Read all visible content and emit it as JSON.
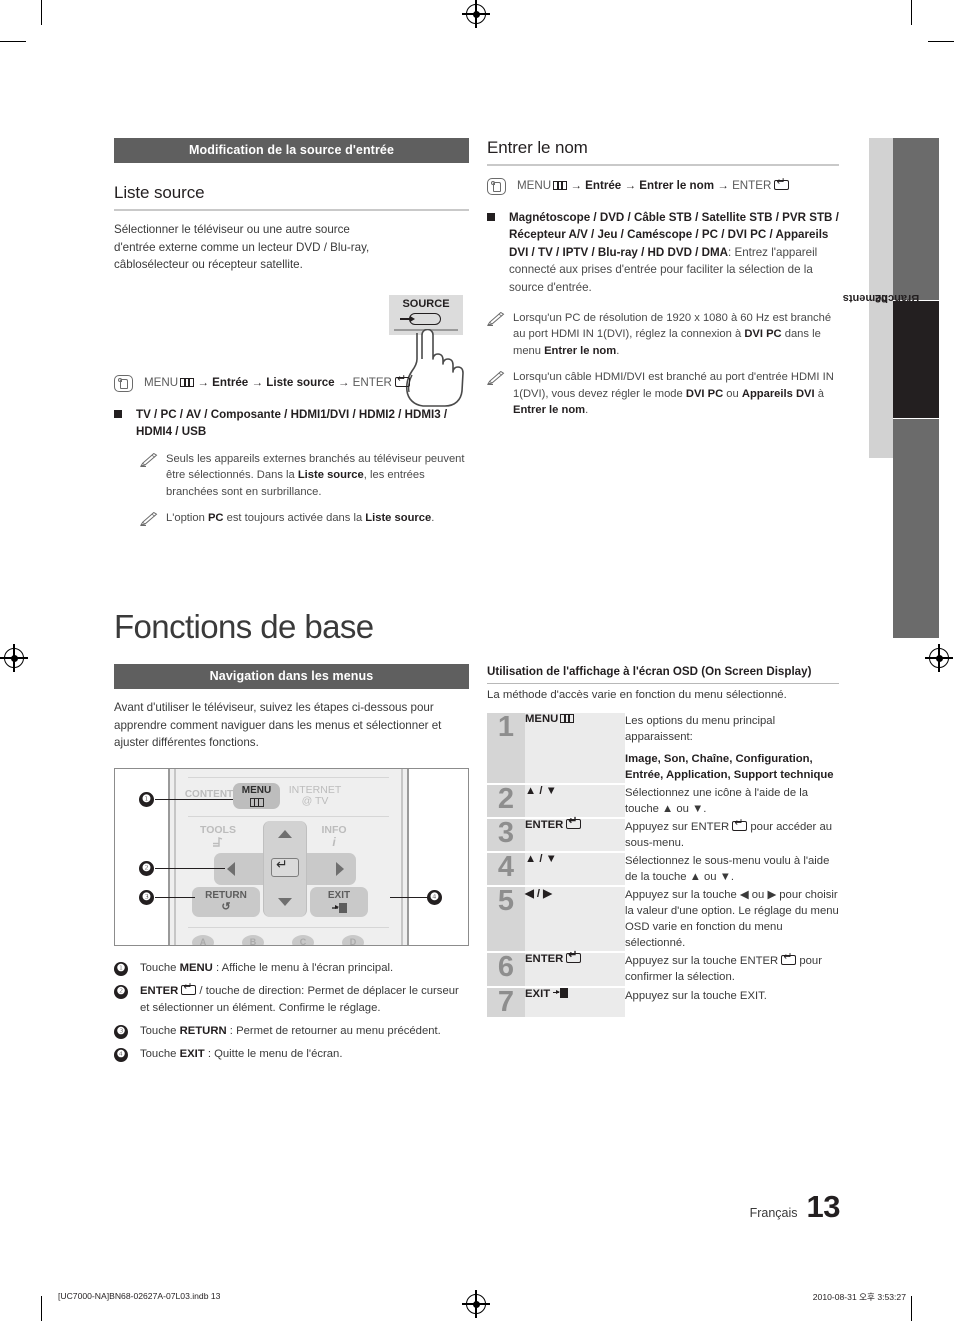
{
  "page": {
    "chapter_tab_number": "02",
    "chapter_tab_label": "Branchements",
    "language": "Français",
    "page_number": "13",
    "print_footer_left": "[UC7000-NA]BN68-02627A-07L03.indb   13",
    "print_footer_right": "2010-08-31   오후 3:53:27"
  },
  "left": {
    "section_bar": "Modification de la source d'entrée",
    "heading": "Liste source",
    "intro": "Sélectionner le téléviseur ou une autre source d'entrée externe comme un lecteur DVD / Blu-ray, câblosélecteur ou récepteur satellite.",
    "source_button_label": "SOURCE",
    "menu_path_pre": "MENU",
    "menu_path_mid": " → Entrée → Liste source → ",
    "menu_path_enter": "ENTER",
    "bullet": "TV / PC / AV / Composante / HDMI1/DVI / HDMI2 / HDMI3 / HDMI4 / USB",
    "notes": [
      "Seuls les appareils externes branchés au téléviseur peuvent être sélectionnés. Dans la Liste source, les entrées branchées sont en surbrillance.",
      "L'option PC est toujours activée dans la Liste source."
    ]
  },
  "right_top": {
    "heading": "Entrer le nom",
    "menu_path_pre": "MENU",
    "menu_path_mid": " → Entrée → Entrer le nom → ",
    "menu_path_enter": "ENTER",
    "bullet_bold": "Magnétoscope / DVD / Câble STB / Satellite STB / PVR STB / Récepteur A/V / Jeu / Caméscope / PC / DVI PC / Appareils DVI / TV / IPTV / Blu-ray / HD DVD / DMA",
    "bullet_rest": ": Entrez l'appareil connecté aux prises d'entrée pour faciliter la sélection de la source d'entrée.",
    "notes": [
      "Lorsqu'un PC de résolution de 1920 x 1080 à 60 Hz est branché au port HDMI IN 1(DVI), réglez la connexion à DVI PC dans le menu Entrer le nom.",
      "Lorsqu'un câble HDMI/DVI est branché au port d'entrée HDMI IN 1(DVI), vous devez régler le mode DVI PC ou Appareils DVI à Entrer le nom."
    ]
  },
  "chapter": {
    "title": "Fonctions de base",
    "section_bar": "Navigation dans les menus",
    "intro": "Avant d'utiliser le téléviseur, suivez les étapes ci-dessous pour apprendre comment naviguer dans les menus et sélectionner et ajuster différentes fonctions."
  },
  "remote": {
    "keys": {
      "content": "CONTENT",
      "menu": "MENU",
      "internet": "INTERNET",
      "internet2": "@ TV",
      "tools": "TOOLS",
      "info": "INFO",
      "return": "RETURN",
      "exit": "EXIT"
    },
    "callouts": [
      "1",
      "2",
      "3",
      "4"
    ],
    "color_buttons": [
      "A",
      "B",
      "C",
      "D"
    ]
  },
  "legend": [
    {
      "num": "1",
      "pre": "Touche ",
      "key": "MENU",
      "post": " : Affiche le menu à l'écran principal."
    },
    {
      "num": "2",
      "pre": "",
      "key": "ENTER",
      "post": " / touche de direction: Permet de déplacer le curseur et sélectionner un élément. Confirme le réglage."
    },
    {
      "num": "3",
      "pre": "Touche ",
      "key": "RETURN",
      "post": " : Permet de retourner au menu précédent."
    },
    {
      "num": "4",
      "pre": "Touche ",
      "key": "EXIT",
      "post": " : Quitte le menu de l'écran."
    }
  ],
  "osd": {
    "heading": "Utilisation de l'affichage à l'écran OSD (On Screen Display)",
    "subtitle": "La méthode d'accès varie en fonction du menu sélectionné.",
    "rows": [
      {
        "num": "1",
        "key": "MENU",
        "key_glyph": "menu",
        "desc_1": "Les options du menu principal apparaissent:",
        "desc_2": "Image, Son, Chaîne, Configuration, Entrée, Application, Support technique"
      },
      {
        "num": "2",
        "key": "▲ / ▼",
        "key_glyph": "none",
        "desc_1": "Sélectionnez une icône à l'aide de la touche ▲ ou ▼.",
        "desc_2": ""
      },
      {
        "num": "3",
        "key": "ENTER",
        "key_glyph": "enter",
        "desc_1": "Appuyez sur ENTER",
        "desc_1b": " pour accéder au sous-menu.",
        "desc_2": ""
      },
      {
        "num": "4",
        "key": "▲ / ▼",
        "key_glyph": "none",
        "desc_1": "Sélectionnez le sous-menu voulu à l'aide de la touche ▲ ou ▼.",
        "desc_2": ""
      },
      {
        "num": "5",
        "key": "◀ / ▶",
        "key_glyph": "none",
        "desc_1": "Appuyez sur la touche ◀ ou ▶ pour choisir la valeur d'une option. Le réglage du menu OSD varie en fonction du menu sélectionné.",
        "desc_2": ""
      },
      {
        "num": "6",
        "key": "ENTER",
        "key_glyph": "enter",
        "desc_1": "Appuyez sur la touche ENTER",
        "desc_1b": " pour confirmer la sélection.",
        "desc_2": ""
      },
      {
        "num": "7",
        "key": "EXIT",
        "key_glyph": "exit",
        "desc_1": "Appuyez sur la touche EXIT.",
        "desc_2": ""
      }
    ]
  },
  "colors": {
    "bar_gray": "#5f5f5f",
    "tab_dark": "#231f20",
    "tab_gray": "#6b6b6b",
    "table_num_bg": "#d5d5d5",
    "table_key_bg": "#ebebeb"
  }
}
